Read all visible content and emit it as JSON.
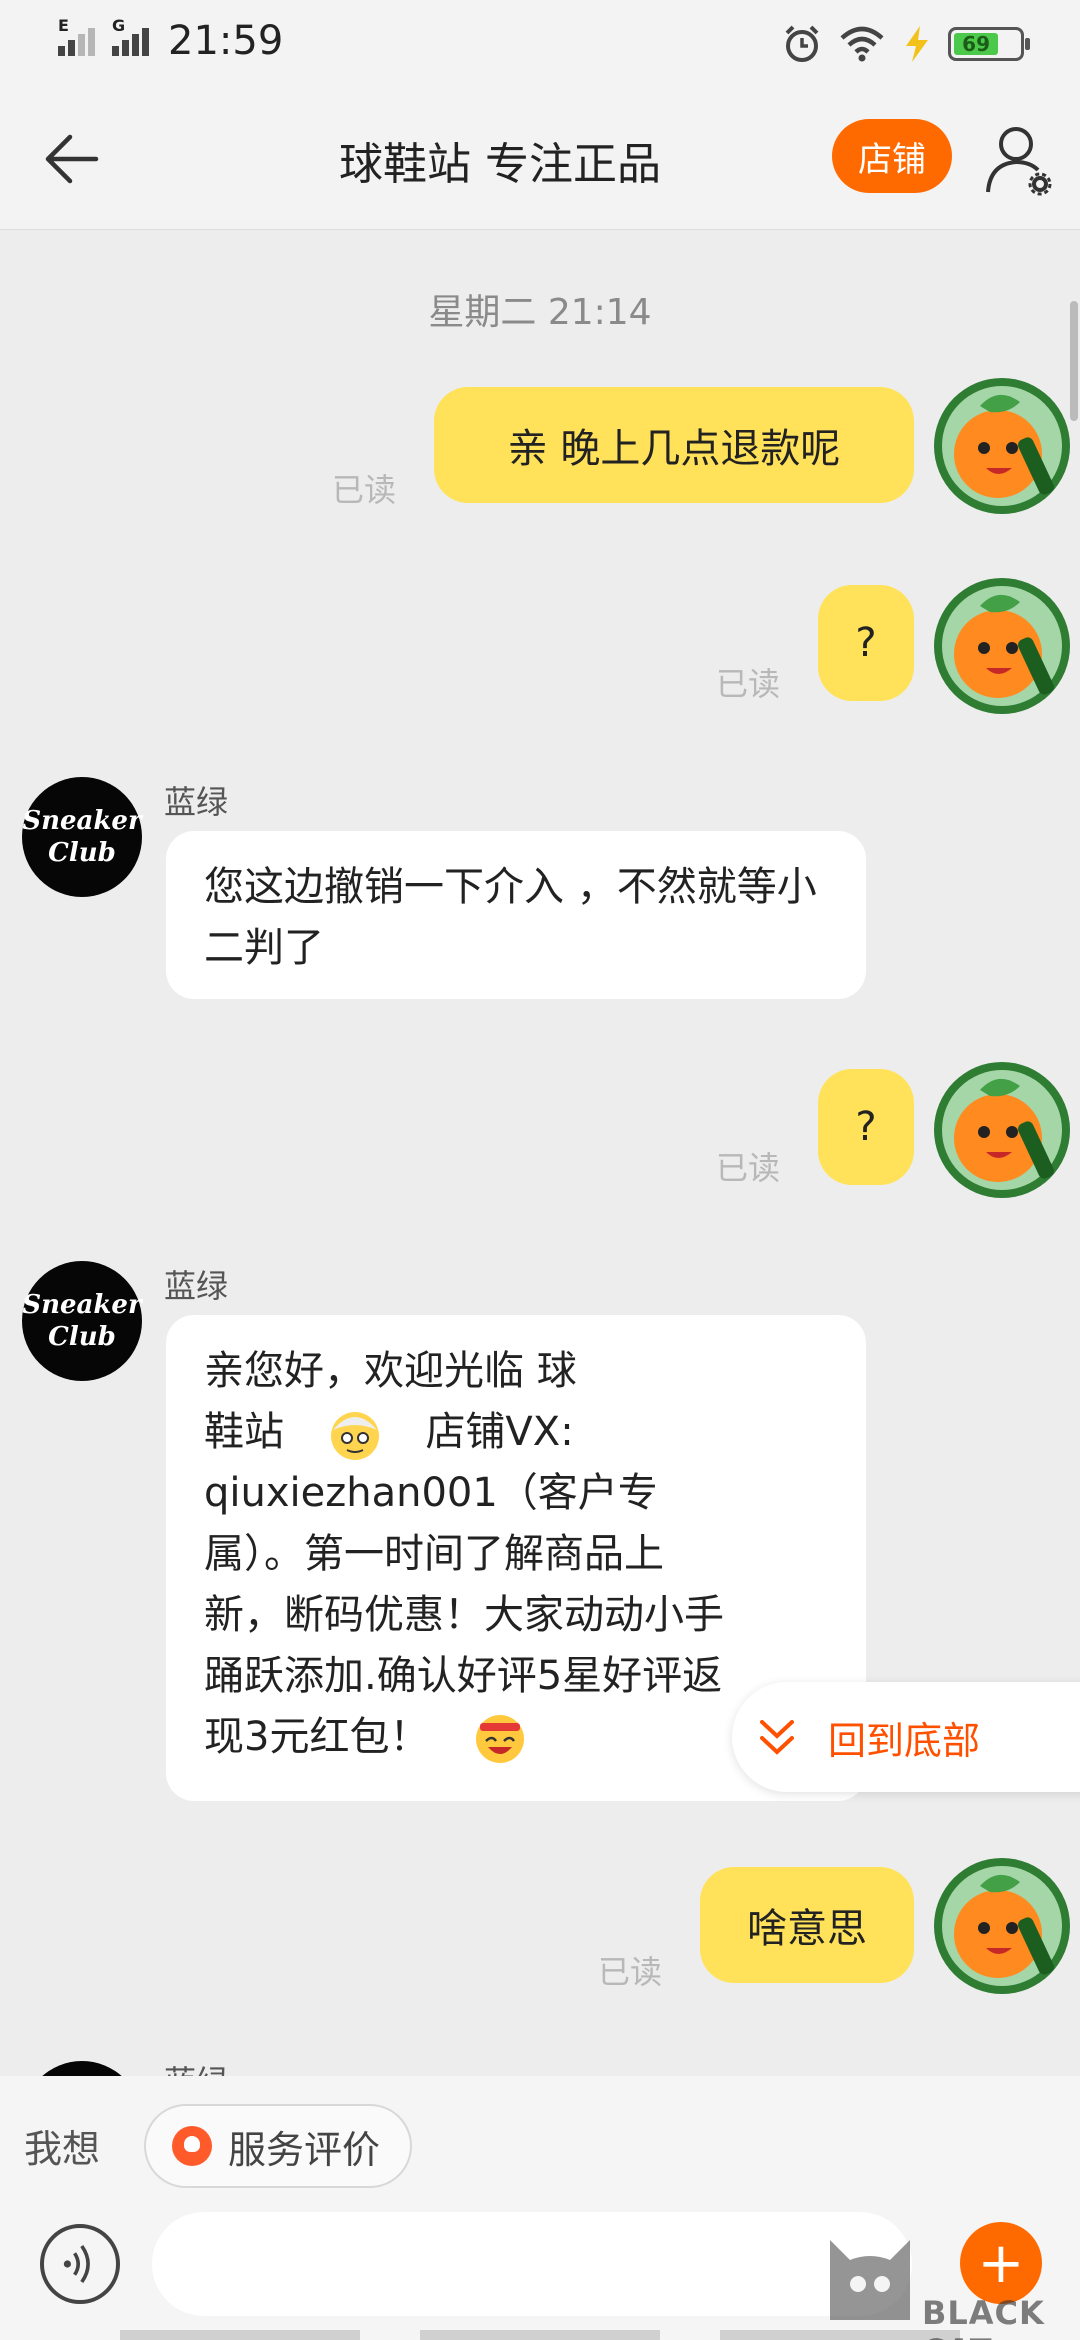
{
  "status_bar": {
    "time": "21:59",
    "sim1_label": "E",
    "sim2_label": "G",
    "battery": "69"
  },
  "header": {
    "title": "球鞋站 专注正品",
    "shop_button": "店铺"
  },
  "chat": {
    "timestamp": "星期二 21:14",
    "messages": [
      {
        "side": "me",
        "text": "亲  晚上几点退款呢",
        "status": "已读"
      },
      {
        "side": "me",
        "text": "?",
        "status": "已读"
      },
      {
        "side": "them",
        "sender": "蓝绿",
        "text": "您这边撤销一下介入 ，不然就等小二判了"
      },
      {
        "side": "me",
        "text": "?",
        "status": "已读"
      },
      {
        "side": "them",
        "sender": "蓝绿",
        "lines": [
          "亲您好，欢迎光临 球",
          "鞋站",
          "店铺VX:",
          "qiuxiezhan001（客户专",
          "属）。第一时间了解商品上",
          "新，断码优惠！大家动动小手",
          "踊跃添加.确认好评5星好评返",
          "现3元红包！"
        ]
      },
      {
        "side": "me",
        "text": "啥意思",
        "status": "已读"
      },
      {
        "side": "them",
        "sender": "蓝绿"
      }
    ],
    "seller_avatar": {
      "line1": "Sneaker",
      "line2": "Club"
    },
    "back_to_bottom": "回到底部"
  },
  "input_area": {
    "quick_label": "我想",
    "quick_chip": "服务评价",
    "message_placeholder": ""
  },
  "watermark": {
    "brand": "BLACK CAT"
  },
  "colors": {
    "accent": "#ff6a00",
    "my_bubble": "#ffe259",
    "their_bubble": "#ffffff",
    "background": "#ededed"
  },
  "icons": [
    "back-arrow-icon",
    "profile-settings-icon",
    "alarm-icon",
    "wifi-icon",
    "charging-icon",
    "battery-icon",
    "voice-icon",
    "plus-icon",
    "double-chevron-down-icon"
  ]
}
